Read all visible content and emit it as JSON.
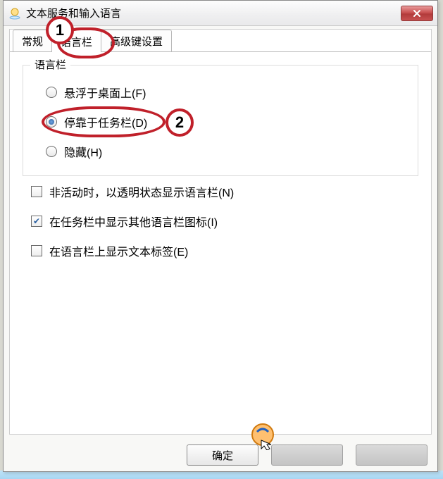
{
  "window": {
    "title": "文本服务和输入语言"
  },
  "tabs": {
    "general": "常规",
    "langbar": "语言栏",
    "advkeys": "高级键设置",
    "active_index": 1
  },
  "group": {
    "legend": "语言栏",
    "radio_float": "悬浮于桌面上(F)",
    "radio_dock": "停靠于任务栏(D)",
    "radio_hide": "隐藏(H)",
    "selected": "dock"
  },
  "checks": {
    "inactive_transparent": {
      "label": "非活动时，以透明状态显示语言栏(N)",
      "checked": false
    },
    "show_extra_icons": {
      "label": "在任务栏中显示其他语言栏图标(I)",
      "checked": true
    },
    "show_text_labels": {
      "label": "在语言栏上显示文本标签(E)",
      "checked": false
    }
  },
  "buttons": {
    "ok": "确定",
    "cancel": "",
    "apply": ""
  },
  "annotations": {
    "step1": "1",
    "step2": "2"
  },
  "colors": {
    "accent": "#c0202a"
  }
}
